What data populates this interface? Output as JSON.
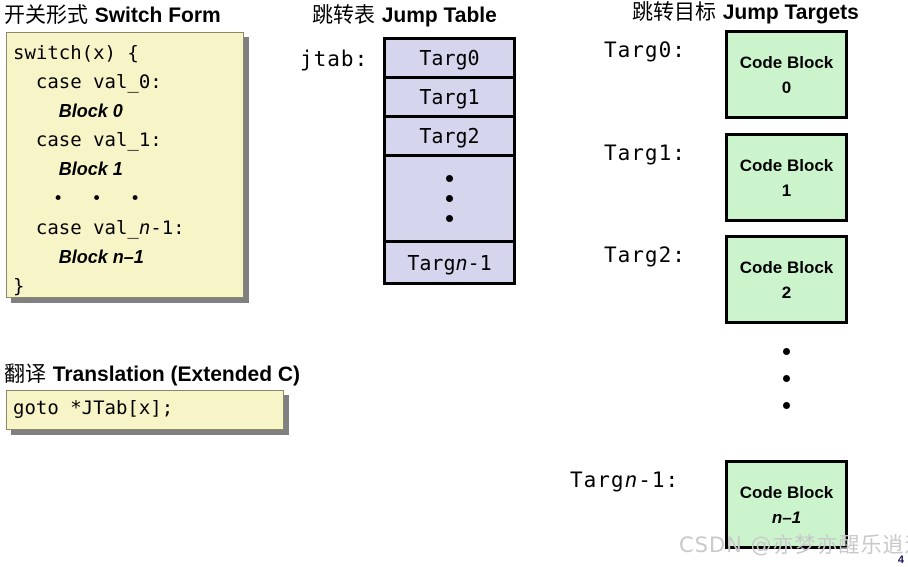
{
  "slide": {
    "page_number": "4",
    "watermark": "CSDN @亦梦亦醒乐逍遥",
    "colors": {
      "switch_box_fill": "#f7f4c8",
      "jump_table_fill": "#d5d5ed",
      "code_block_fill": "#ccf4cc",
      "border": "#000000",
      "watermark_text": "#c9c9c9"
    }
  },
  "switch_form": {
    "heading_cn": "开关形式 ",
    "heading_en": "Switch Form",
    "lines": [
      {
        "code": "switch(x) {"
      },
      {
        "code": "  case val_0:"
      },
      {
        "code": "    ",
        "italic": "Block",
        "tail": " 0"
      },
      {
        "code": "  case val_1:"
      },
      {
        "code": "    ",
        "italic": "Block",
        "tail": " 1"
      },
      {
        "ellipsis": "• • •"
      },
      {
        "code": "  case val_",
        "italic_var": "n",
        "tail_code": "-1:"
      },
      {
        "code": "    ",
        "italic": "Block",
        "italic_tail_var": " n",
        "tail": "–1"
      },
      {
        "code": "}"
      }
    ]
  },
  "translation": {
    "heading_cn": "翻译 ",
    "heading_en": "Translation (Extended C)",
    "code": "goto *JTab[x];"
  },
  "jump_table": {
    "heading_cn": "跳转表 ",
    "heading_en": "Jump Table",
    "label": "jtab:",
    "cells": [
      {
        "text": "Targ0"
      },
      {
        "text": "Targ1"
      },
      {
        "text": "Targ2"
      },
      {
        "dots": 3
      },
      {
        "text_prefix": "Targ",
        "text_var": "n",
        "text_suffix": "-1"
      }
    ]
  },
  "jump_targets": {
    "heading_cn": "跳转目标 ",
    "heading_en": "Jump Targets",
    "dots_count": 3,
    "entries": [
      {
        "label": "Targ0:",
        "block_title": "Code Block",
        "block_num": "0",
        "num_italic": false
      },
      {
        "label": "Targ1:",
        "block_title": "Code Block",
        "block_num": "1",
        "num_italic": false
      },
      {
        "label": "Targ2:",
        "block_title": "Code Block",
        "block_num": "2",
        "num_italic": false
      },
      {
        "label_prefix": "Targ",
        "label_var": "n",
        "label_suffix": "-1:",
        "block_title": "Code Block",
        "block_num": "n–1",
        "num_italic": true
      }
    ]
  }
}
